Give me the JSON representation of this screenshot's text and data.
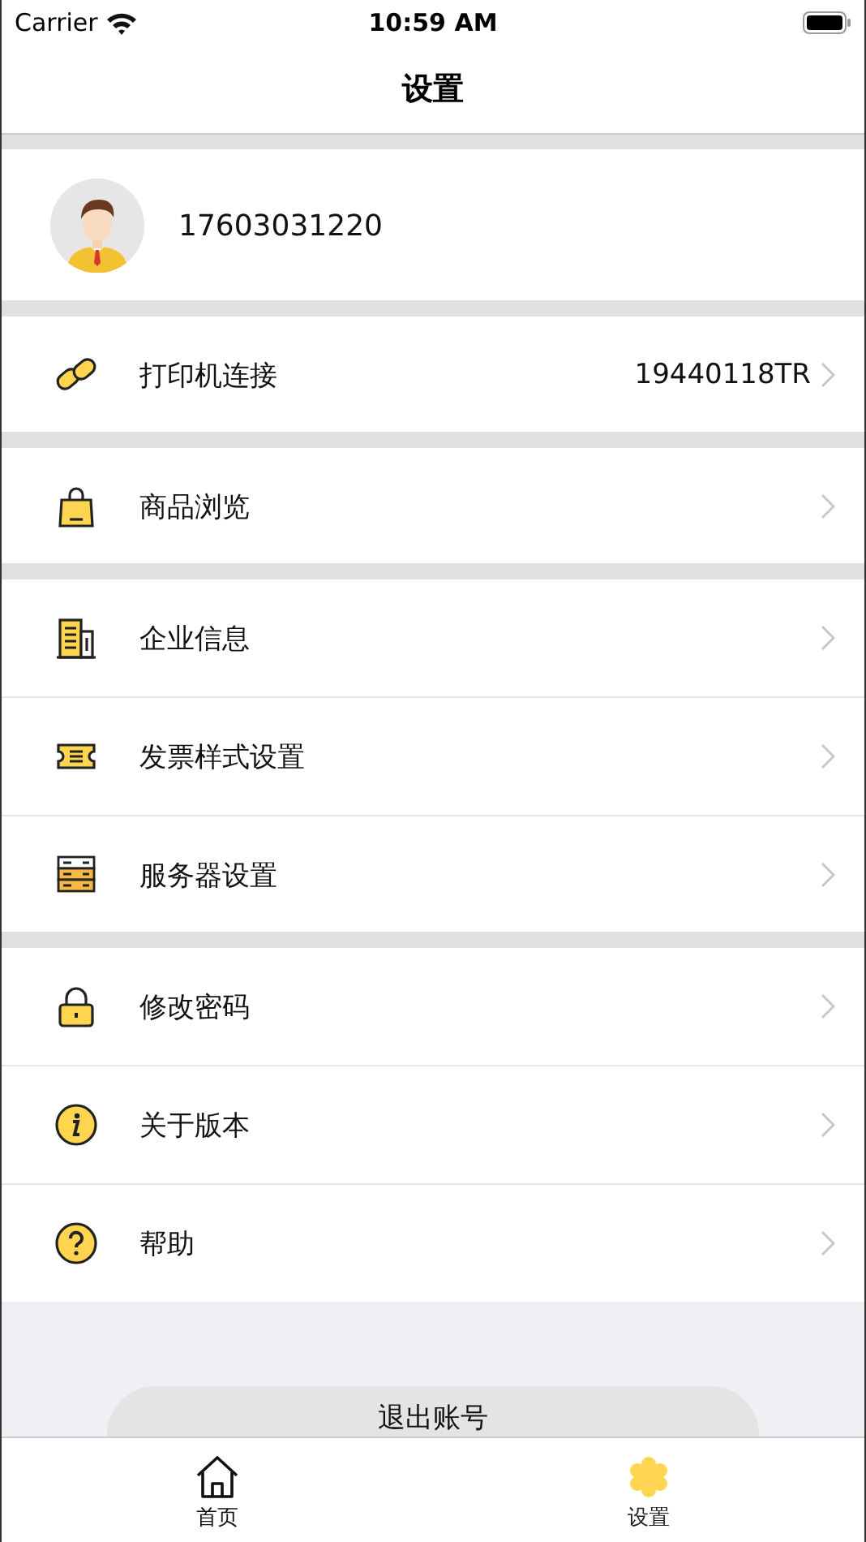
{
  "status_bar": {
    "carrier": "Carrier",
    "time": "10:59 AM"
  },
  "nav": {
    "title": "设置"
  },
  "profile": {
    "phone": "17603031220"
  },
  "sections": [
    {
      "items": [
        {
          "kind": "link",
          "label": "打印机连接",
          "value": "19440118TR"
        }
      ]
    },
    {
      "items": [
        {
          "kind": "bag",
          "label": "商品浏览"
        }
      ]
    },
    {
      "items": [
        {
          "kind": "building",
          "label": "企业信息"
        },
        {
          "kind": "ticket",
          "label": "发票样式设置"
        },
        {
          "kind": "server",
          "label": "服务器设置"
        }
      ]
    },
    {
      "items": [
        {
          "kind": "lock",
          "label": "修改密码"
        },
        {
          "kind": "info",
          "label": "关于版本"
        },
        {
          "kind": "help",
          "label": "帮助"
        }
      ]
    }
  ],
  "logout_button": "退出账号",
  "tabs": [
    {
      "kind": "home",
      "label": "首页",
      "selected": false
    },
    {
      "kind": "flower",
      "label": "设置",
      "selected": true
    }
  ]
}
